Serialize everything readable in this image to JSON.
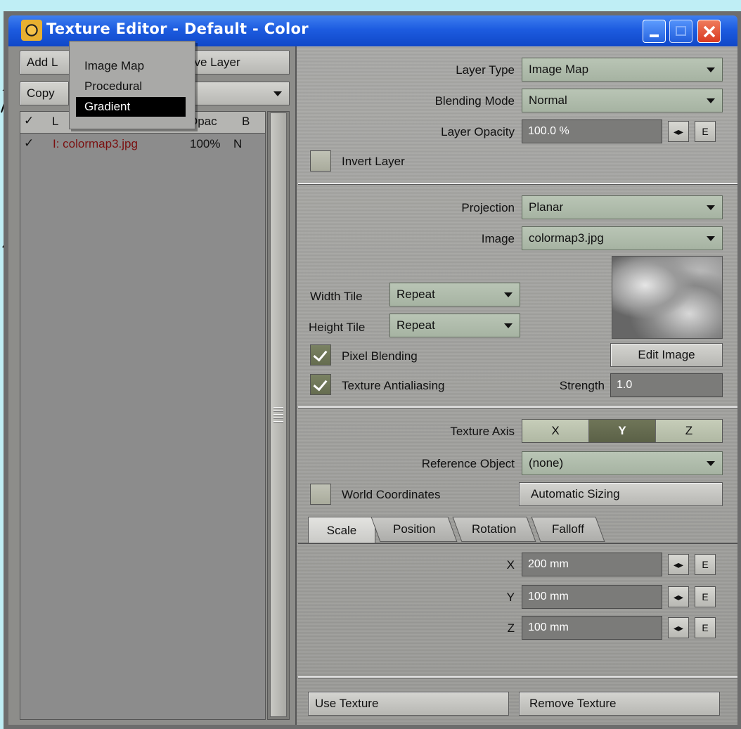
{
  "window": {
    "title": "Texture Editor - Default - Color"
  },
  "left": {
    "add_layer": "Add L",
    "remove_layer": "ove Layer",
    "copy": "Copy",
    "copy_select": "e",
    "headers": {
      "check": "✓",
      "layer": "L",
      "opac": "Opac",
      "blend": "B"
    },
    "rows": [
      {
        "check": "✓",
        "name": "I: colormap3.jpg",
        "opac": "100%",
        "blend": "N"
      }
    ]
  },
  "popup": {
    "items": [
      "Image Map",
      "Procedural",
      "Gradient"
    ],
    "selected": "Gradient"
  },
  "layer": {
    "layer_type_label": "Layer Type",
    "layer_type_value": "Image Map",
    "blending_label": "Blending Mode",
    "blending_value": "Normal",
    "opacity_label": "Layer Opacity",
    "opacity_value": "100.0 %",
    "invert_label": "Invert Layer"
  },
  "image": {
    "projection_label": "Projection",
    "projection_value": "Planar",
    "image_label": "Image",
    "image_value": "colormap3.jpg",
    "width_tile_label": "Width Tile",
    "width_tile_value": "Repeat",
    "height_tile_label": "Height Tile",
    "height_tile_value": "Repeat",
    "pixel_blending_label": "Pixel Blending",
    "pixel_blending": true,
    "antialias_label": "Texture Antialiasing",
    "antialias": true,
    "edit_image": "Edit Image",
    "strength_label": "Strength",
    "strength_value": "1.0"
  },
  "axis": {
    "label": "Texture Axis",
    "options": [
      "X",
      "Y",
      "Z"
    ],
    "selected": "Y",
    "ref_label": "Reference Object",
    "ref_value": "(none)",
    "world_label": "World Coordinates",
    "auto_sizing": "Automatic Sizing"
  },
  "tabs": [
    "Scale",
    "Position",
    "Rotation",
    "Falloff"
  ],
  "active_tab": "Scale",
  "scale": {
    "x_label": "X",
    "x_value": "200 mm",
    "y_label": "Y",
    "y_value": "100 mm",
    "z_label": "Z",
    "z_value": "100 mm",
    "e": "E",
    "arrows": "◂▸"
  },
  "footer": {
    "use_texture": "Use Texture",
    "remove_texture": "Remove Texture"
  },
  "colors": {
    "titlebar": "#1d5ce0",
    "background": "#bfeef5",
    "close": "#d93a22",
    "selected_layer_text": "#7a1010"
  }
}
